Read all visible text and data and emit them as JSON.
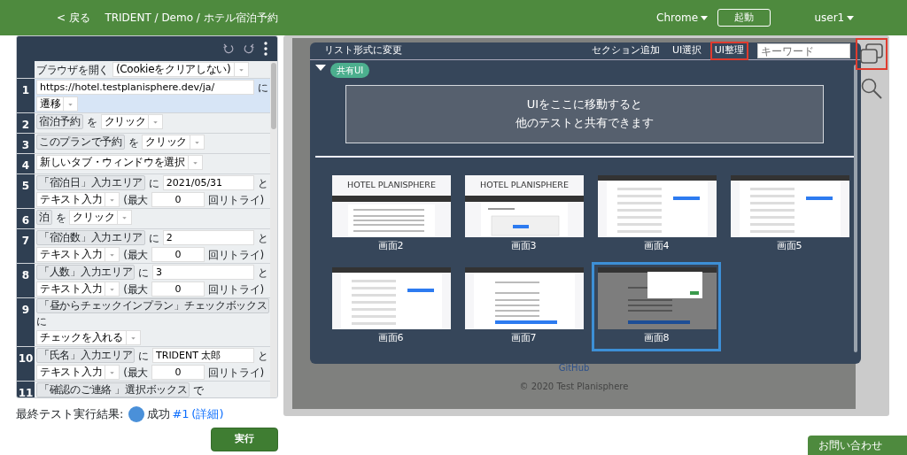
{
  "navbar": {
    "back": "< 戻る",
    "breadcrumb": "TRIDENT / Demo / ホテル宿泊予約",
    "browser": "Chrome",
    "launch": "起動",
    "user": "user1"
  },
  "steps": [
    {
      "selected": false,
      "lines": [
        [
          {
            "kind": "word",
            "text": "ブラウザを開く"
          },
          {
            "kind": "select",
            "text": "(Cookieをクリアしない)"
          }
        ]
      ]
    },
    {
      "number": "1",
      "selected": true,
      "lines": [
        [
          {
            "kind": "input",
            "value": "https://hotel.testplanisphere.dev/ja/"
          },
          {
            "kind": "word",
            "text": "に"
          }
        ],
        [
          {
            "kind": "select",
            "text": "遷移"
          }
        ]
      ]
    },
    {
      "number": "2",
      "selected": false,
      "lines": [
        [
          {
            "kind": "chip",
            "text": "宿泊予約"
          },
          {
            "kind": "word",
            "text": "を"
          },
          {
            "kind": "select",
            "text": "クリック"
          }
        ]
      ]
    },
    {
      "number": "3",
      "selected": false,
      "lines": [
        [
          {
            "kind": "chip",
            "text": "このプランで予約"
          },
          {
            "kind": "word",
            "text": "を"
          },
          {
            "kind": "select",
            "text": "クリック"
          }
        ]
      ]
    },
    {
      "number": "4",
      "selected": false,
      "lines": [
        [
          {
            "kind": "select",
            "text": "新しいタブ・ウィンドウを選択"
          }
        ]
      ]
    },
    {
      "number": "5",
      "selected": false,
      "lines": [
        [
          {
            "kind": "chip",
            "text": "「宿泊日」入力エリア"
          },
          {
            "kind": "word",
            "text": "に"
          },
          {
            "kind": "input",
            "value": "2021/05/31"
          },
          {
            "kind": "word",
            "text": "と"
          }
        ],
        [
          {
            "kind": "select",
            "text": "テキスト入力"
          },
          {
            "kind": "word",
            "text": "(最大"
          },
          {
            "kind": "count",
            "value": "0"
          },
          {
            "kind": "word",
            "text": "回リトライ)"
          }
        ]
      ]
    },
    {
      "number": "6",
      "selected": false,
      "lines": [
        [
          {
            "kind": "chip",
            "text": "泊"
          },
          {
            "kind": "word",
            "text": "を"
          },
          {
            "kind": "select",
            "text": "クリック"
          }
        ]
      ]
    },
    {
      "number": "7",
      "selected": false,
      "lines": [
        [
          {
            "kind": "chip",
            "text": "「宿泊数」入力エリア"
          },
          {
            "kind": "word",
            "text": "に"
          },
          {
            "kind": "input",
            "value": "2"
          },
          {
            "kind": "word",
            "text": "と"
          }
        ],
        [
          {
            "kind": "select",
            "text": "テキスト入力"
          },
          {
            "kind": "word",
            "text": "(最大"
          },
          {
            "kind": "count",
            "value": "0"
          },
          {
            "kind": "word",
            "text": "回リトライ)"
          }
        ]
      ]
    },
    {
      "number": "8",
      "selected": false,
      "lines": [
        [
          {
            "kind": "chip",
            "text": "「人数」入力エリア"
          },
          {
            "kind": "word",
            "text": "に"
          },
          {
            "kind": "input",
            "value": "3"
          },
          {
            "kind": "word",
            "text": "と"
          }
        ],
        [
          {
            "kind": "select",
            "text": "テキスト入力"
          },
          {
            "kind": "word",
            "text": "(最大"
          },
          {
            "kind": "count",
            "value": "0"
          },
          {
            "kind": "word",
            "text": "回リトライ)"
          }
        ]
      ]
    },
    {
      "number": "9",
      "selected": false,
      "lines": [
        [
          {
            "kind": "chip",
            "text": "「昼からチェックインプラン」チェックボックス"
          },
          {
            "kind": "word",
            "text": "に"
          }
        ],
        [
          {
            "kind": "select",
            "text": "チェックを入れる"
          }
        ]
      ]
    },
    {
      "number": "10",
      "selected": false,
      "lines": [
        [
          {
            "kind": "chip",
            "text": "「氏名」入力エリア"
          },
          {
            "kind": "word",
            "text": "に"
          },
          {
            "kind": "input",
            "value": "TRIDENT 太郎"
          },
          {
            "kind": "word",
            "text": "と"
          }
        ],
        [
          {
            "kind": "select",
            "text": "テキスト入力"
          },
          {
            "kind": "word",
            "text": "(最大"
          },
          {
            "kind": "count",
            "value": "0"
          },
          {
            "kind": "word",
            "text": "回リトライ)"
          }
        ]
      ]
    },
    {
      "number": "11",
      "selected": false,
      "lines": [
        [
          {
            "kind": "chip",
            "text": "「確認のご連絡 」選択ボックス"
          },
          {
            "kind": "word",
            "text": "で"
          }
        ]
      ]
    }
  ],
  "result": {
    "label": "最終テスト実行結果:",
    "status": "成功",
    "run": "#1",
    "details": "(詳細)"
  },
  "run_button": "実行",
  "ui_panel": {
    "list_toggle": "リスト形式に変更",
    "actions": [
      {
        "label": "セクション追加",
        "highlighted": false
      },
      {
        "label": "UI選択",
        "highlighted": false
      },
      {
        "label": "UI整理",
        "highlighted": true
      }
    ],
    "search": {
      "placeholder": "キーワード"
    },
    "section": {
      "expanded": true,
      "badge": "共有UI"
    },
    "dropzone": [
      "UIをここに移動すると",
      "他のテストと共有できます"
    ],
    "screens": [
      {
        "label": "画面2",
        "kind": "home",
        "header": "HOTEL PLANISPHERE",
        "selected": false
      },
      {
        "label": "画面3",
        "kind": "list",
        "header": "HOTEL PLANISPHERE",
        "selected": false
      },
      {
        "label": "画面4",
        "kind": "form",
        "selected": false
      },
      {
        "label": "画面5",
        "kind": "form",
        "selected": false
      },
      {
        "label": "画面6",
        "kind": "form",
        "selected": false
      },
      {
        "label": "画面7",
        "kind": "confirm",
        "selected": false
      },
      {
        "label": "画面8",
        "kind": "modal",
        "selected": true
      }
    ]
  },
  "preview_footer": {
    "link": "GitHub",
    "copyright": "© 2020 Test Planisphere"
  },
  "side_tools": [
    {
      "kind": "windows",
      "highlighted": true
    },
    {
      "kind": "search",
      "highlighted": false
    }
  ],
  "contact": "お問い合わせ"
}
